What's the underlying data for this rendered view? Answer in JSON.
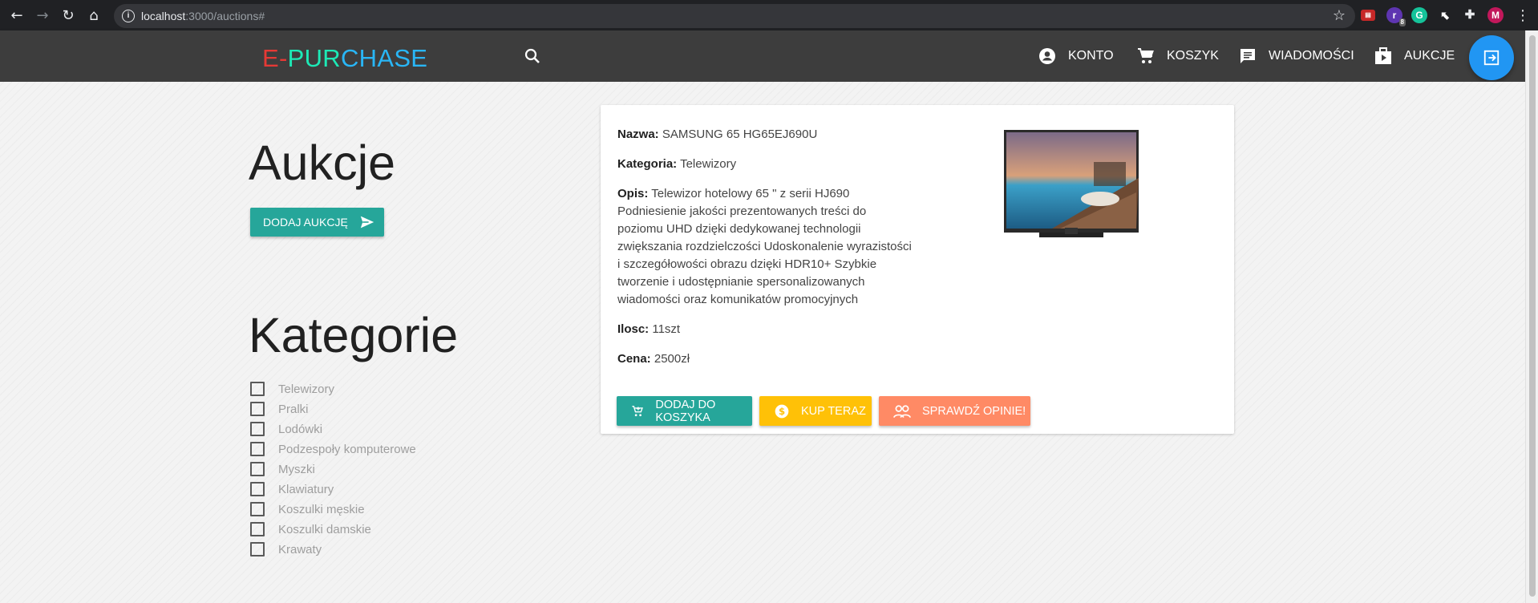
{
  "browser": {
    "url_host": "localhost",
    "url_rest": ":3000/auctions#",
    "extensions": [
      "pdf-extension-icon",
      "r-extension-icon",
      "grammarly-icon",
      "mouse-extension-icon",
      "puzzle-icon",
      "profile-avatar-icon"
    ],
    "ext_badge": "8",
    "profile_initial": "M"
  },
  "header": {
    "logo_part1": "E-",
    "logo_part2": "PUR",
    "logo_part3": "CHASE",
    "nav": {
      "account": "KONTO",
      "cart": "KOSZYK",
      "messages": "WIADOMOŚCI",
      "auctions": "AUKCJE"
    }
  },
  "sidebar": {
    "title": "Aukcje",
    "add_button": "DODAJ AUKCJĘ",
    "categories_title": "Kategorie",
    "categories": [
      "Telewizory",
      "Pralki",
      "Lodówki",
      "Podzespoły komputerowe",
      "Myszki",
      "Klawiatury",
      "Koszulki męskie",
      "Koszulki damskie",
      "Krawaty"
    ]
  },
  "product": {
    "name_label": "Nazwa:",
    "name": "SAMSUNG 65 HG65EJ690U",
    "category_label": "Kategoria:",
    "category": "Telewizory",
    "desc_label": "Opis:",
    "description": "Telewizor hotelowy 65 \" z serii HJ690 Podniesienie jakości prezentowanych treści do poziomu UHD dzięki dedykowanej technologii zwiększania rozdzielczości Udoskonalenie wyrazistości i szczegółowości obrazu dzięki HDR10+ Szybkie tworzenie i udostępnianie spersonalizowanych wiadomości oraz komunikatów promocyjnych",
    "qty_label": "Ilosc:",
    "qty": "11szt",
    "price_label": "Cena:",
    "price": "2500zł",
    "btn_cart": "DODAJ DO KOSZYKA",
    "btn_buy": "KUP TERAZ",
    "btn_reviews": "SPRAWDŹ OPINIE!"
  },
  "colors": {
    "teal": "#26a69a",
    "amber": "#ffc107",
    "salmon": "#ff8a65",
    "blue": "#2196f3",
    "appbar": "#3d3d3d"
  }
}
